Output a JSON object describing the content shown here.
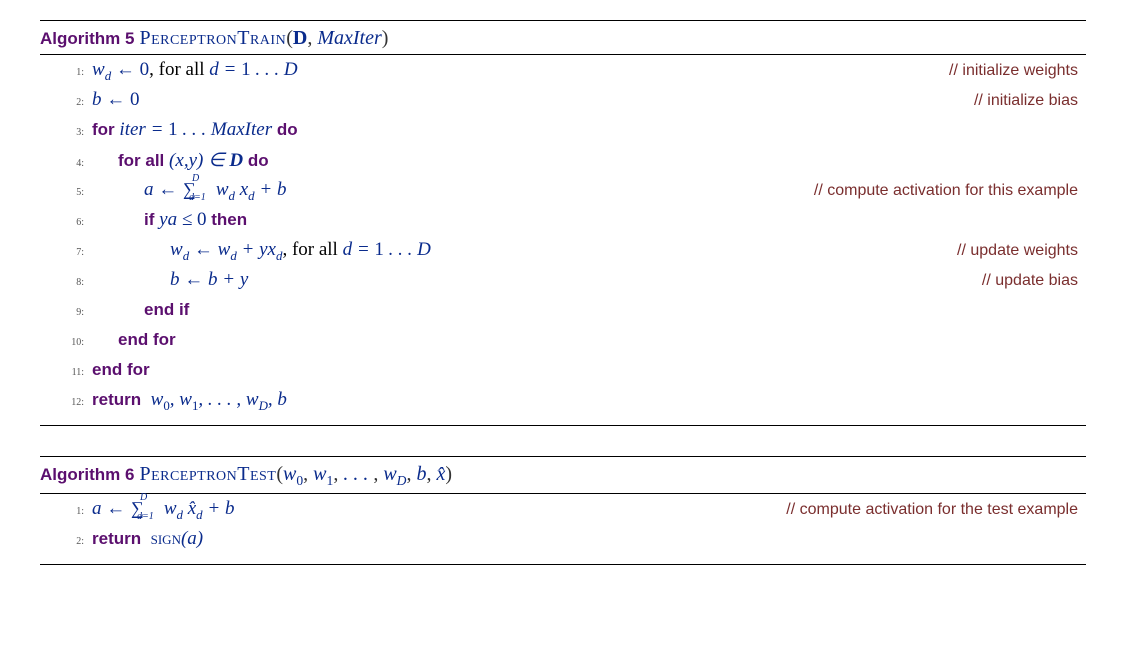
{
  "algorithms": [
    {
      "number": "5",
      "name": "PerceptronTrain",
      "params_html": "(<span class='param-D'>D</span>, <span class='param'>MaxIter</span>)",
      "lines": [
        {
          "n": "1:",
          "indent": 0,
          "html": "<span class='m'>w<sub>d</sub></span> <span class='m'>←</span> <span class='mup'>0</span><span class='txt'>, for all </span> <span class='m'>d</span> <span class='m'>=</span> <span class='mup'>1</span> <span class='m'>. . .</span> <span class='m'>D</span>",
          "comment": "// initialize weights"
        },
        {
          "n": "2:",
          "indent": 0,
          "html": "<span class='m'>b</span> <span class='m'>←</span> <span class='mup'>0</span>",
          "comment": "// initialize bias"
        },
        {
          "n": "3:",
          "indent": 0,
          "html": "<span class='kw'>for</span> <span class='m'>iter</span> <span class='m'>=</span> <span class='mup'>1</span> <span class='m'>. . .</span> <span class='m'>MaxIter</span> <span class='kw'>do</span>"
        },
        {
          "n": "4:",
          "indent": 1,
          "html": "<span class='kw'>for all</span> <span class='m'>(</span><span class='m'>x</span><span class='m'>,</span><span class='m'>y</span><span class='m'>)</span> <span class='m'>∈</span> <span class='mb'>D</span> <span class='kw'>do</span>"
        },
        {
          "n": "5:",
          "indent": 2,
          "html": "<span class='m'>a</span> <span class='m'>←</span> <span class='sum m'><span class='sup'>D</span><span class='sig'>∑</span><span class='sub'>d=1</span></span>&nbsp;&nbsp;&nbsp; <span class='m'>w<sub>d</sub></span> <span class='m'>x<sub>d</sub></span> <span class='m'>+</span> <span class='m'>b</span>",
          "comment": "// compute activation for this example"
        },
        {
          "n": "6:",
          "indent": 2,
          "html": "<span class='kw'>if</span> <span class='m'>ya</span> <span class='m'>≤</span> <span class='mup'>0</span> <span class='kw'>then</span>"
        },
        {
          "n": "7:",
          "indent": 3,
          "html": "<span class='m'>w<sub>d</sub></span> <span class='m'>←</span> <span class='m'>w<sub>d</sub></span> <span class='m'>+</span> <span class='m'>yx<sub>d</sub></span><span class='txt'>, for all </span> <span class='m'>d</span> <span class='m'>=</span> <span class='mup'>1</span> <span class='m'>. . .</span> <span class='m'>D</span>",
          "comment": "// update weights"
        },
        {
          "n": "8:",
          "indent": 3,
          "html": "<span class='m'>b</span> <span class='m'>←</span> <span class='m'>b</span> <span class='m'>+</span> <span class='m'>y</span>",
          "comment": "// update bias"
        },
        {
          "n": "9:",
          "indent": 2,
          "html": "<span class='kw'>end if</span>"
        },
        {
          "n": "10:",
          "indent": 1,
          "html": "<span class='kw'>end for</span>"
        },
        {
          "n": "11:",
          "indent": 0,
          "html": "<span class='kw'>end for</span>"
        },
        {
          "n": "12:",
          "indent": 0,
          "html": "<span class='kw'>return</span>&nbsp; <span class='m'>w</span><sub class='mup'>0</sub><span class='m'>,</span> <span class='m'>w</span><sub class='mup'>1</sub><span class='m'>,</span> <span class='m'>. . . ,</span> <span class='m'>w<sub>D</sub></span><span class='m'>,</span> <span class='m'>b</span>"
        }
      ]
    },
    {
      "number": "6",
      "name": "PerceptronTest",
      "params_html": "(<span class='param'>w</span><sub class='param' style='font-style:normal'>0</sub>, <span class='param'>w</span><sub class='param' style='font-style:normal'>1</sub>, <span class='param'>. . .</span> , <span class='param'>w<sub>D</sub></span>, <span class='param'>b</span>, <span class='param'>x̂</span>)",
      "lines": [
        {
          "n": "1:",
          "indent": 0,
          "html": "<span class='m'>a</span> <span class='m'>←</span> <span class='sum m'><span class='sup'>D</span><span class='sig'>∑</span><span class='sub'>d=1</span></span>&nbsp;&nbsp;&nbsp; <span class='m'>w<sub>d</sub></span> <span class='m'>x̂<sub>d</sub></span> <span class='m'>+</span> <span class='m'>b</span>",
          "comment": "// compute activation for the test example"
        },
        {
          "n": "2:",
          "indent": 0,
          "html": "<span class='kw'>return</span>&nbsp; <span class='sc'>sign</span><span class='m'>(a)</span>"
        }
      ]
    }
  ]
}
